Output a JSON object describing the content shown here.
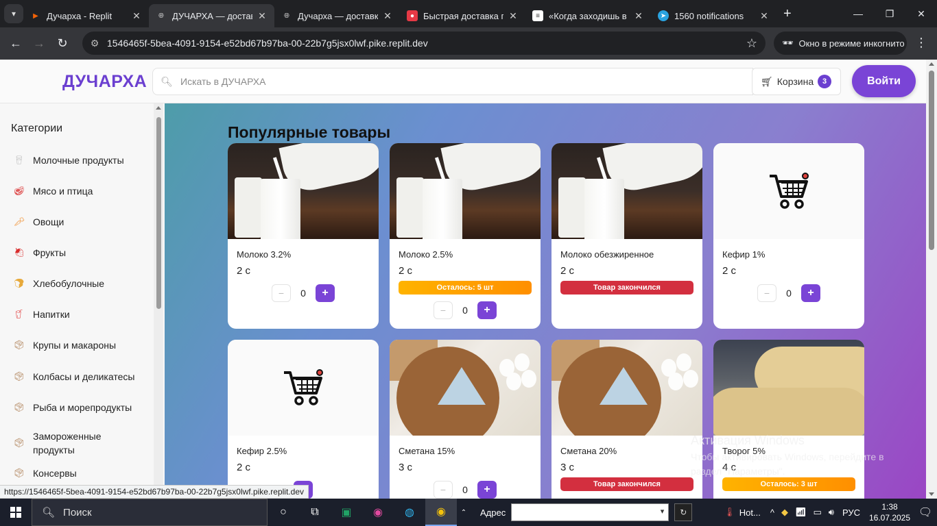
{
  "browser": {
    "tabs": [
      {
        "title": "Дучарха - Replit",
        "color": "#f26207"
      },
      {
        "title": "ДУЧАРХА — доставка",
        "color": "#9aa0a6"
      },
      {
        "title": "Дучарха — доставка",
        "color": "#9aa0a6"
      },
      {
        "title": "Быстрая доставка пр",
        "color": "#e53945"
      },
      {
        "title": "«Когда заходишь в с",
        "color": "#ffffff"
      },
      {
        "title": "1560 notifications",
        "color": "#2aa3e0"
      }
    ],
    "url": "1546465f-5bea-4091-9154-e52bd67b97ba-00-22b7g5jsx0lwf.pike.replit.dev",
    "incognito_label": "Окно в режиме инкогнито",
    "status_url": "https://1546465f-5bea-4091-9154-e52bd67b97ba-00-22b7g5jsx0lwf.pike.replit.dev"
  },
  "header": {
    "logo": "ДУЧАРХА",
    "search_placeholder": "Искать в ДУЧАРХА",
    "cart_label": "Корзина",
    "cart_count": "3",
    "login_label": "Войти"
  },
  "sidebar": {
    "title": "Категории",
    "items": [
      {
        "label": "Молочные продукты",
        "icon": "milk-icon"
      },
      {
        "label": "Мясо и птица",
        "icon": "meat-icon"
      },
      {
        "label": "Овощи",
        "icon": "carrot-icon"
      },
      {
        "label": "Фрукты",
        "icon": "strawberry-icon"
      },
      {
        "label": "Хлебобулочные",
        "icon": "bread-icon"
      },
      {
        "label": "Напитки",
        "icon": "drink-icon"
      },
      {
        "label": "Крупы и макароны",
        "icon": "box-icon"
      },
      {
        "label": "Колбасы и деликатесы",
        "icon": "box-icon"
      },
      {
        "label": "Рыба и морепродукты",
        "icon": "box-icon"
      },
      {
        "label": "Замороженные продукты",
        "icon": "box-icon"
      },
      {
        "label": "Консервы",
        "icon": "box-icon"
      }
    ]
  },
  "main": {
    "section_title": "Популярные товары",
    "products": [
      {
        "name": "Молоко 3.2%",
        "price": "2 с",
        "qty": "0",
        "image": "milk"
      },
      {
        "name": "Молоко 2.5%",
        "price": "2 с",
        "qty": "0",
        "image": "milk",
        "stock": "Осталось: 5 шт"
      },
      {
        "name": "Молоко обезжиренное",
        "price": "2 с",
        "image": "milk",
        "stock": "Товар закончился"
      },
      {
        "name": "Кефир 1%",
        "price": "2 с",
        "qty": "0",
        "image": "cart"
      },
      {
        "name": "Кефир 2.5%",
        "price": "2 с",
        "image": "cart"
      },
      {
        "name": "Сметана 15%",
        "price": "3 с",
        "qty": "0",
        "image": "cheese"
      },
      {
        "name": "Сметана 20%",
        "price": "3 с",
        "image": "cheese",
        "stock": "Товар закончился"
      },
      {
        "name": "Творог 5%",
        "price": "4 с",
        "image": "tvorog",
        "stock": "Осталось: 3 шт"
      }
    ]
  },
  "windows_watermark": {
    "title": "Активация Windows",
    "text": "Чтобы активировать Windows, перейдите в раздел \"Параметры\"."
  },
  "taskbar": {
    "search_label": "Поиск",
    "address_label": "Адрес",
    "weather_label": "Hot...",
    "lang": "РУС",
    "time": "1:38",
    "date": "16.07.2025"
  }
}
